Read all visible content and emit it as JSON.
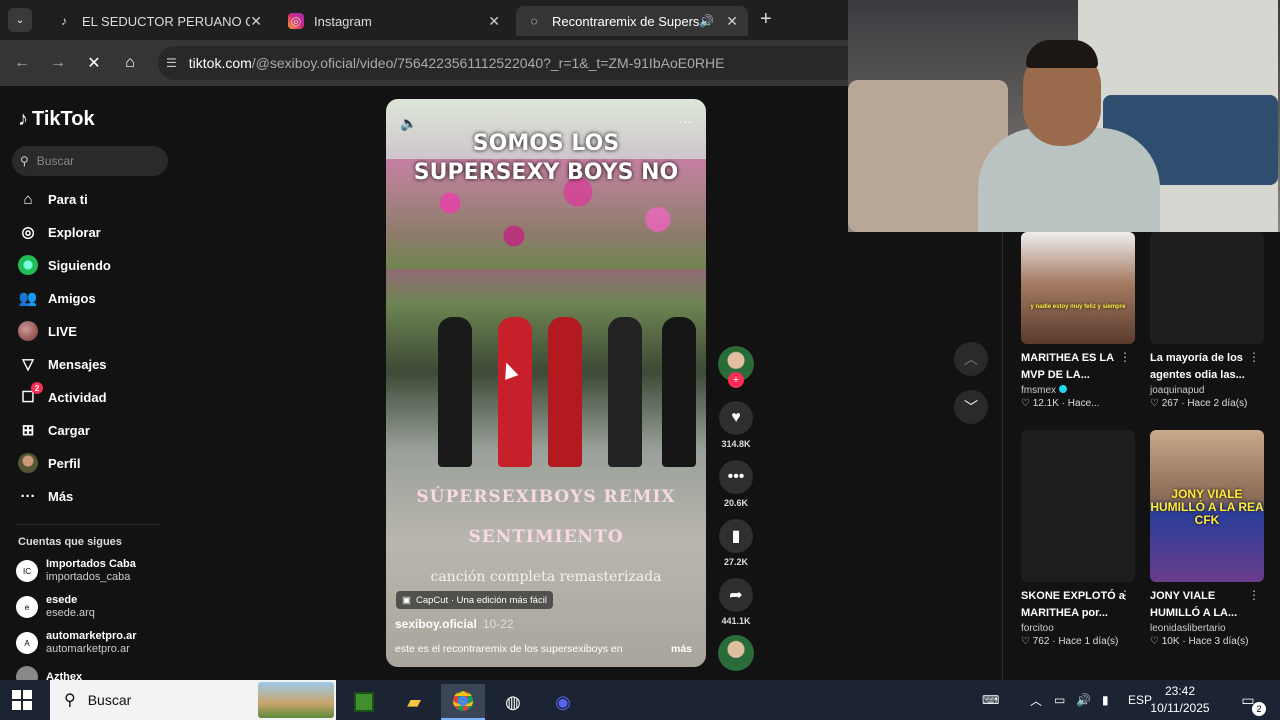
{
  "browser": {
    "tabs": [
      {
        "title": "EL SEDUCTOR PERUANO QUE C",
        "icon": "tiktok-icon"
      },
      {
        "title": "Instagram",
        "icon": "instagram-icon"
      },
      {
        "title": "Recontraremix de Supersexi",
        "icon": "loading-icon"
      }
    ],
    "url_host": "tiktok.com",
    "url_path": "/@sexiboy.oficial/video/7564223561112522040?_r=1&_t=ZM-91IbAoE0RHE"
  },
  "sidebar": {
    "brand": "TikTok",
    "search_placeholder": "Buscar",
    "nav": [
      {
        "label": "Para ti",
        "icon": "home-icon"
      },
      {
        "label": "Explorar",
        "icon": "compass-icon"
      },
      {
        "label": "Siguiendo",
        "icon": "following-icon"
      },
      {
        "label": "Amigos",
        "icon": "friends-icon"
      },
      {
        "label": "LIVE",
        "icon": "live-icon"
      },
      {
        "label": "Mensajes",
        "icon": "messages-icon"
      },
      {
        "label": "Actividad",
        "icon": "activity-icon",
        "badge": "2"
      },
      {
        "label": "Cargar",
        "icon": "upload-icon"
      },
      {
        "label": "Perfil",
        "icon": "profile-icon"
      },
      {
        "label": "Más",
        "icon": "more-icon"
      }
    ],
    "following_title": "Cuentas que sigues",
    "following": [
      {
        "name": "Importados Caba",
        "handle": "importados_caba"
      },
      {
        "name": "esede",
        "handle": "esede.arq"
      },
      {
        "name": "automarketpro.ar",
        "handle": "automarketpro.ar"
      },
      {
        "name": "Azthex",
        "handle": ""
      }
    ]
  },
  "video": {
    "overlay_top_1": "SOMOS LOS",
    "overlay_top_2": "SUPERSEXY BOYS NO",
    "overlay_mid_1": "SÚPERSEXIBOYS REMIX",
    "overlay_mid_2": "SENTIMIENTO",
    "overlay_bottom": "canción completa remasterizada",
    "capcut": "CapCut · Una edición más fácil",
    "author": "sexiboy.oficial",
    "date": "10-22",
    "description": "este es el recontraremix de los supersexiboys en",
    "more": "más"
  },
  "actions": {
    "likes": "314.8K",
    "comments": "20.6K",
    "saves": "27.2K",
    "shares": "441.1K"
  },
  "related": [
    {
      "title": "MARITHEA ES LA MVP DE LA...",
      "user": "fmsmex",
      "likes": "12.1K",
      "time": "Hace...",
      "thumb_text": "y nadie estoy muy feliz y siempre",
      "verified": true
    },
    {
      "title": "La mayoría de los agentes odia las...",
      "user": "joaquinapud",
      "likes": "267",
      "time": "Hace 2 día(s)",
      "thumb_text": ""
    },
    {
      "title": "SKONE EXPLOTÓ a MARITHEA por...",
      "user": "forcitoo",
      "likes": "762",
      "time": "Hace 1 día(s)",
      "thumb_text": ""
    },
    {
      "title": "JONY VIALE HUMILLÓ A LA...",
      "user": "leonidaslibertario",
      "likes": "10K",
      "time": "Hace 3 día(s)",
      "thumb_text": "JONY VIALE HUMILLÓ A LA REA CFK"
    }
  ],
  "taskbar": {
    "search_placeholder": "Buscar",
    "lang": "ESP",
    "time": "23:42",
    "date": "10/11/2025",
    "notifications": "2"
  },
  "colors": {
    "accent": "#fe2c55",
    "background": "#121212"
  }
}
